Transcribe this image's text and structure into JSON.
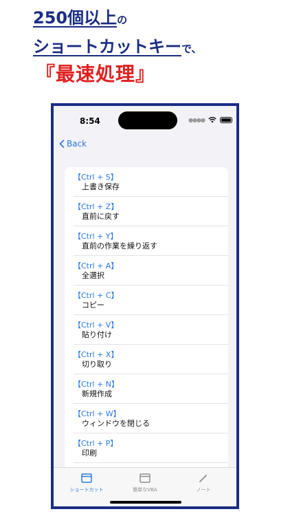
{
  "headline": {
    "line1_big": "250個以上",
    "line1_small": "の",
    "line2_big": "ショートカットキー",
    "line2_small": "で、",
    "line3": "『最速処理』"
  },
  "colors": {
    "navy": "#1b2d83",
    "red": "#e02020",
    "accent": "#2a7ae2"
  },
  "status_bar": {
    "time": "8:54",
    "icons": [
      "signal-dots-icon",
      "wifi-icon",
      "battery-icon"
    ]
  },
  "nav": {
    "back_label": "Back"
  },
  "list": {
    "items": [
      {
        "key": "【Ctrl + S】",
        "desc": "上書き保存"
      },
      {
        "key": "【Ctrl + Z】",
        "desc": "直前に戻す"
      },
      {
        "key": "【Ctrl + Y】",
        "desc": "直前の作業を繰り返す"
      },
      {
        "key": "【Ctrl + A】",
        "desc": "全選択"
      },
      {
        "key": "【Ctrl + C】",
        "desc": "コピー"
      },
      {
        "key": "【Ctrl + V】",
        "desc": "貼り付け"
      },
      {
        "key": "【Ctrl + X】",
        "desc": "切り取り"
      },
      {
        "key": "【Ctrl + N】",
        "desc": "新規作成"
      },
      {
        "key": "【Ctrl + W】",
        "desc": "ウィンドウを閉じる"
      },
      {
        "key": "【Ctrl + P】",
        "desc": "印刷"
      }
    ]
  },
  "tabs": [
    {
      "label": "ショートカット",
      "icon": "window-icon",
      "active": true
    },
    {
      "label": "簡単なVBA",
      "icon": "window-icon",
      "active": false
    },
    {
      "label": "ノート",
      "icon": "pencil-icon",
      "active": false
    }
  ]
}
